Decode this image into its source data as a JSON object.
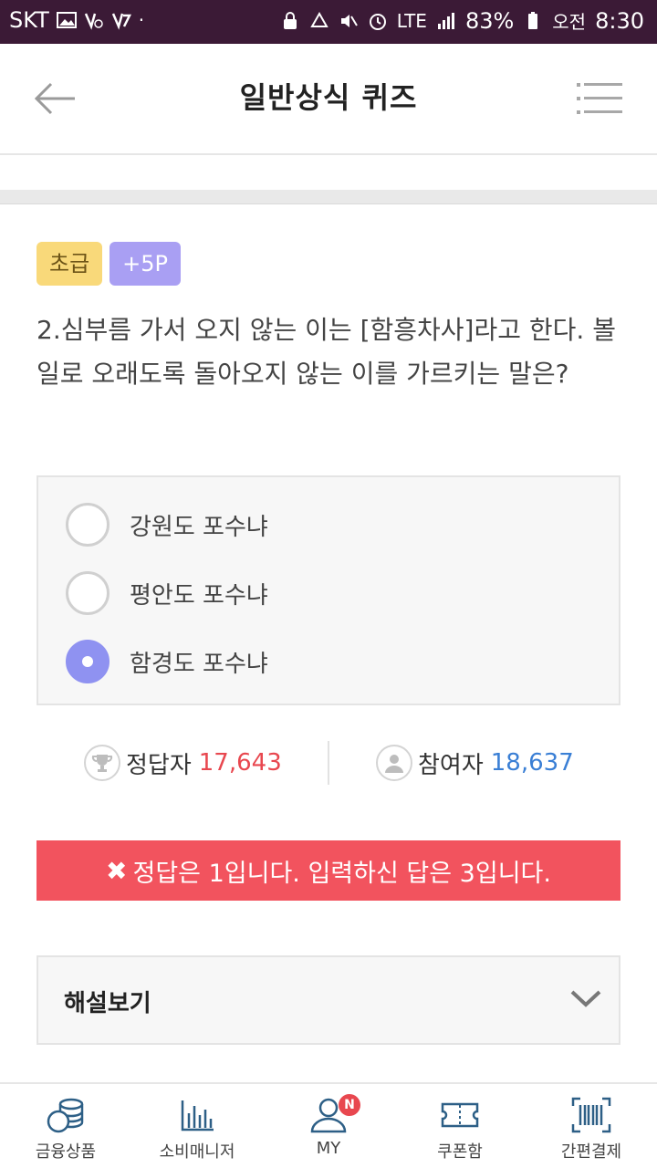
{
  "status_bar": {
    "carrier": "SKT",
    "network": "LTE",
    "battery": "83%",
    "ampm": "오전",
    "time": "8:30"
  },
  "header": {
    "title": "일반상식 퀴즈"
  },
  "quiz": {
    "level_badge": "초급",
    "points_badge": "+5P",
    "question": "2.심부름 가서 오지 않는 이는 [함흥차사]라고 한다. 볼일로 오래도록 돌아오지 않는 이를 가르키는 말은?",
    "options": [
      {
        "label": "강원도 포수냐",
        "selected": false
      },
      {
        "label": "평안도 포수냐",
        "selected": false
      },
      {
        "label": "함경도 포수냐",
        "selected": true
      }
    ]
  },
  "stats": {
    "correct_label": "정답자",
    "correct_count": "17,643",
    "participants_label": "참여자",
    "participants_count": "18,637"
  },
  "result": {
    "icon": "✖",
    "message": "정답은 1입니다. 입력하신 답은 3입니다."
  },
  "explanation": {
    "label": "해설보기"
  },
  "bottom_nav": {
    "items": [
      {
        "label": "금융상품",
        "icon": "coins-icon"
      },
      {
        "label": "소비매니저",
        "icon": "bar-chart-icon"
      },
      {
        "label": "MY",
        "icon": "user-icon",
        "badge": "N"
      },
      {
        "label": "쿠폰함",
        "icon": "ticket-icon"
      },
      {
        "label": "간편결제",
        "icon": "barcode-icon"
      }
    ]
  },
  "colors": {
    "status_bar": "#3b1a36",
    "level_badge": "#f9d97a",
    "points_badge": "#a99ff3",
    "selected_radio": "#8f92f1",
    "result_banner": "#f2535e",
    "correct_count": "#e8474f",
    "participants_count": "#3a7fd5"
  }
}
